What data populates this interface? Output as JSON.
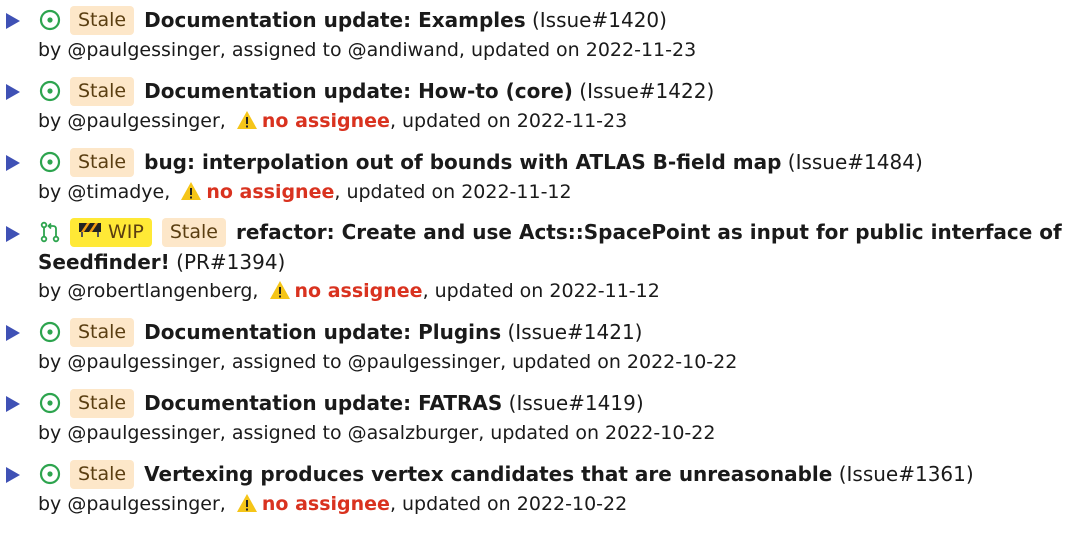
{
  "stale_label": "Stale",
  "wip_label": "WIP",
  "no_assignee": "no assignee",
  "colors": {
    "triangle": "#3f51b5",
    "open_icon": "#2da44e",
    "stale_bg": "#fde7c9",
    "wip_bg": "#ffe936",
    "warning": "#d9321f"
  },
  "items": [
    {
      "type": "issue",
      "title": "Documentation update: Examples",
      "ref": "(Issue#1420)",
      "by": "by @paulgessinger,",
      "assign": " assigned to @andiwand,",
      "updated": " updated on 2022-11-23"
    },
    {
      "type": "issue",
      "title": "Documentation update: How-to (core)",
      "ref": "(Issue#1422)",
      "by": "by @paulgessinger,",
      "updated": ", updated on 2022-11-23"
    },
    {
      "type": "issue",
      "title": "bug: interpolation out of bounds with ATLAS B-field map",
      "ref": "(Issue#1484)",
      "by": "by @timadye,",
      "updated": ", updated on 2022-11-12"
    },
    {
      "type": "pr",
      "title_part1": "refactor: Create and use Acts::SpacePoint as input for public interface of",
      "title_part2": "Seedfinder!",
      "ref": "(PR#1394)",
      "by": "by @robertlangenberg,",
      "updated": ", updated on 2022-11-12"
    },
    {
      "type": "issue",
      "title": "Documentation update: Plugins",
      "ref": "(Issue#1421)",
      "by": "by @paulgessinger,",
      "assign": " assigned to @paulgessinger,",
      "updated": " updated on 2022-10-22"
    },
    {
      "type": "issue",
      "title": "Documentation update: FATRAS",
      "ref": "(Issue#1419)",
      "by": "by @paulgessinger,",
      "assign": " assigned to @asalzburger,",
      "updated": " updated on 2022-10-22"
    },
    {
      "type": "issue",
      "title": "Vertexing produces vertex candidates that are unreasonable",
      "ref": "(Issue#1361)",
      "by": "by @paulgessinger,",
      "updated": ", updated on 2022-10-22"
    }
  ]
}
